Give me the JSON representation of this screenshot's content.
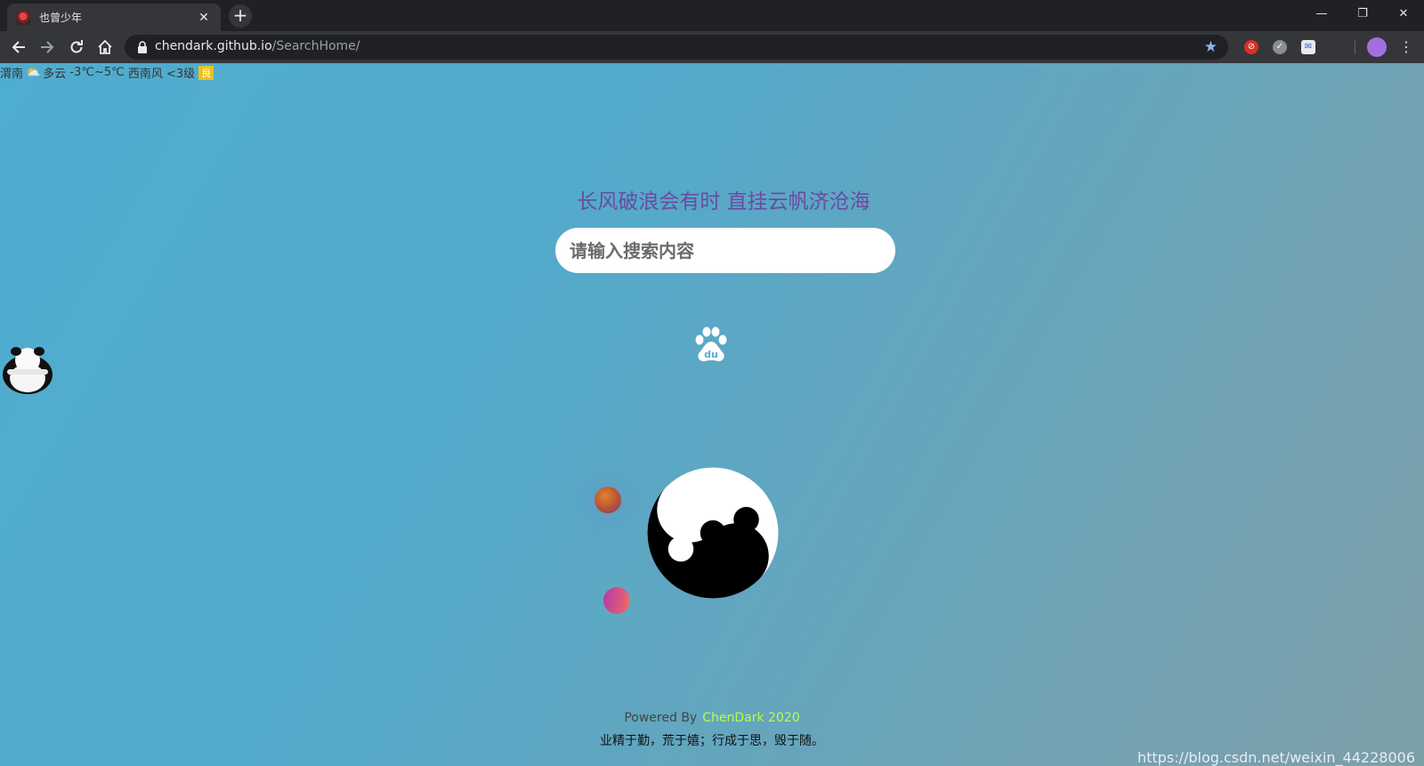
{
  "browser": {
    "tab_title": "也曾少年",
    "tab_close": "✕",
    "new_tab": "+",
    "window_controls": {
      "minimize": "—",
      "restore": "❐",
      "close": "✕"
    },
    "url_host": "chendark.github.io",
    "url_path": "/SearchHome/",
    "icons": [
      "back-arrow-icon",
      "forward-arrow-icon",
      "reload-icon",
      "home-icon",
      "lock-icon",
      "star-icon",
      "extension-icon",
      "profile-icon",
      "menu-icon"
    ]
  },
  "weather": {
    "city": "渭南",
    "condition": "多云",
    "temperature": "-3℃~5℃",
    "wind": "西南风 <3级",
    "aqi": "良"
  },
  "main": {
    "slogan": "长风破浪会有时 直挂云帆济沧海",
    "search_placeholder": "请输入搜索内容"
  },
  "footer": {
    "powered_label": "Powered By",
    "powered_brand": "ChenDark 2020",
    "motto": "业精于勤，荒于嬉；行成于思，毁于随。",
    "watermark": "https://blog.csdn.net/weixin_44228006"
  },
  "colors": {
    "slogan": "#6b4aa3",
    "brand": "#b5ff45",
    "chrome_dark": "#202124",
    "toolbar": "#35363a"
  }
}
